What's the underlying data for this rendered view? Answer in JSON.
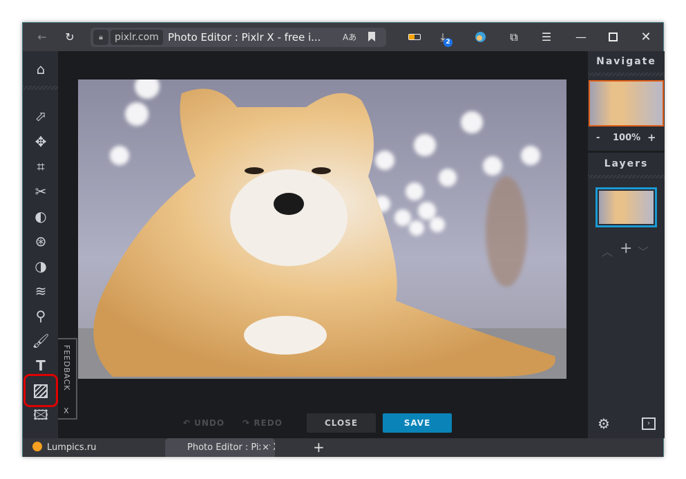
{
  "browser": {
    "domain": "pixlr.com",
    "page_title": "Photo Editor : Pixlr X - free i...",
    "downloads_badge": "2",
    "icons": [
      "back-icon",
      "reload-icon",
      "lock-icon",
      "translate-icon",
      "bookmark-icon",
      "battery-icon",
      "download-icon",
      "weather-icon",
      "collections-icon",
      "menu-icon",
      "minimize-icon",
      "maximize-icon",
      "close-icon"
    ]
  },
  "tools": [
    {
      "name": "home"
    },
    {
      "name": "arrange"
    },
    {
      "name": "move"
    },
    {
      "name": "crop"
    },
    {
      "name": "cutout"
    },
    {
      "name": "adjust"
    },
    {
      "name": "filter"
    },
    {
      "name": "effect"
    },
    {
      "name": "liquify"
    },
    {
      "name": "retouch"
    },
    {
      "name": "draw"
    },
    {
      "name": "text"
    },
    {
      "name": "element",
      "selected": true
    },
    {
      "name": "add-image"
    }
  ],
  "feedback": {
    "label": "FEEDBACK",
    "close": "X"
  },
  "actions": {
    "undo": "UNDO",
    "redo": "REDO",
    "close": "CLOSE",
    "save": "SAVE"
  },
  "navigate": {
    "title": "Navigate",
    "zoom_out": "-",
    "zoom": "100%",
    "zoom_in": "+"
  },
  "layers": {
    "title": "Layers",
    "add": "+"
  },
  "tabs": [
    {
      "label": "Lumpics.ru"
    },
    {
      "label": "Photo Editor : Pixlr X - fre",
      "close": "×"
    }
  ],
  "new_tab": "+",
  "colors": {
    "save": "#0a84b8",
    "selection": "#e00000",
    "layer_border": "#1a9ad6",
    "nav_border": "#e0601a"
  }
}
